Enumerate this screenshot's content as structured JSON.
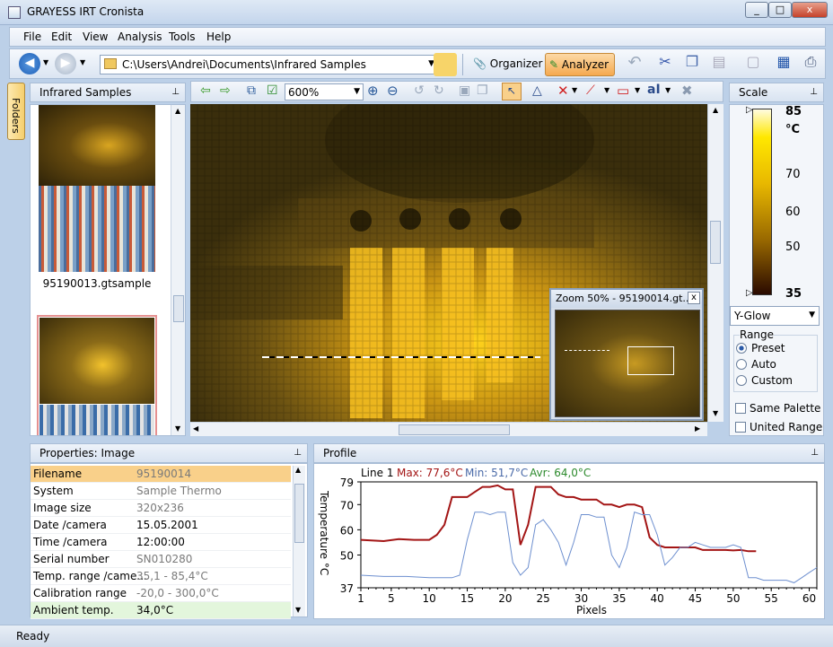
{
  "window": {
    "title": "GRAYESS IRT Cronista",
    "min": "_",
    "max": "□",
    "close": "x"
  },
  "menu": [
    "File",
    "Edit",
    "View",
    "Analysis",
    "Tools",
    "Help"
  ],
  "toolbar": {
    "path": "C:\\Users\\Andrei\\Documents\\Infrared Samples",
    "organizer": "Organizer",
    "analyzer": "Analyzer"
  },
  "side_tab": "Folders",
  "thumbs": {
    "title": "Infrared Samples",
    "item1": "95190013.gtsample"
  },
  "view_toolbar": {
    "zoom": "600%"
  },
  "zoom_window": {
    "title": "Zoom 50% - 95190014.gt...",
    "close": "x"
  },
  "scale": {
    "title": "Scale",
    "max": "85",
    "unit": "°C",
    "ticks": [
      "70",
      "60",
      "50"
    ],
    "min": "35",
    "palette": "Y-Glow",
    "range_label": "Range",
    "preset": "Preset",
    "auto": "Auto",
    "custom": "Custom",
    "same_palette": "Same Palette",
    "united_range": "United Range"
  },
  "properties": {
    "title": "Properties: Image",
    "rows": [
      {
        "k": "Filename",
        "v": "95190014"
      },
      {
        "k": "System",
        "v": "Sample Thermo"
      },
      {
        "k": "Image size",
        "v": "320x236"
      },
      {
        "k": "Date /camera",
        "v": "15.05.2001"
      },
      {
        "k": "Time /camera",
        "v": "12:00:00"
      },
      {
        "k": "Serial number",
        "v": "SN010280"
      },
      {
        "k": "Temp. range /came...",
        "v": "35,1 - 85,4°C"
      },
      {
        "k": "Calibration range",
        "v": "-20,0 - 300,0°C"
      },
      {
        "k": "Ambient temp.",
        "v": "34,0°C"
      }
    ]
  },
  "profile": {
    "title": "Profile",
    "line": "Line 1",
    "max": "Max: 77,6°C",
    "min": "Min: 51,7°C",
    "avr": "Avr: 64,0°C",
    "ylabel": "Temperature °C",
    "xlabel": "Pixels"
  },
  "status": "Ready",
  "colors": {
    "accent": "#f5a94f",
    "max": "#a31515",
    "min": "#6d8fcf",
    "avr": "#2c8a2c"
  },
  "chart_data": {
    "type": "line",
    "title": "",
    "xlabel": "Pixels",
    "ylabel": "Temperature °C",
    "xlim": [
      1,
      61
    ],
    "ylim": [
      37,
      79
    ],
    "xticks": [
      1,
      5,
      10,
      15,
      20,
      25,
      30,
      35,
      40,
      45,
      50,
      55,
      60
    ],
    "yticks": [
      37,
      50,
      60,
      70,
      79
    ],
    "series": [
      {
        "name": "Max",
        "x": [
          1,
          4,
          6,
          8,
          10,
          11,
          12,
          13,
          14,
          15,
          16,
          17,
          18,
          19,
          20,
          21,
          22,
          23,
          24,
          25,
          26,
          27,
          28,
          29,
          30,
          31,
          32,
          33,
          34,
          35,
          36,
          37,
          38,
          39,
          40,
          41,
          42,
          43,
          44,
          45,
          46,
          47,
          48,
          49,
          50,
          51,
          52,
          53
        ],
        "y": [
          56,
          55.5,
          56.3,
          56,
          56,
          58,
          62,
          73,
          73,
          73,
          75,
          77,
          77,
          77.6,
          76,
          76,
          54,
          62,
          77,
          77,
          77,
          74,
          73,
          73,
          72,
          72,
          72,
          70,
          70,
          69,
          70,
          70,
          69,
          57,
          54,
          53,
          53,
          53,
          53,
          53,
          52,
          52,
          52,
          52,
          51.8,
          52,
          51.5,
          51.5
        ]
      },
      {
        "name": "Min",
        "x": [
          1,
          4,
          7,
          10,
          13,
          14,
          15,
          16,
          17,
          18,
          19,
          20,
          21,
          22,
          23,
          24,
          25,
          26,
          27,
          28,
          29,
          30,
          31,
          32,
          33,
          34,
          35,
          36,
          37,
          38,
          39,
          40,
          41,
          42,
          43,
          44,
          45,
          46,
          47,
          48,
          49,
          50,
          51,
          52,
          53,
          54,
          55,
          56,
          57,
          58,
          59,
          60,
          61
        ],
        "y": [
          42,
          41.5,
          41.5,
          41,
          41,
          42,
          56,
          67,
          67,
          66,
          67,
          67,
          47,
          42,
          45,
          62,
          64,
          60,
          55,
          46,
          55,
          66,
          66,
          65,
          65,
          50,
          45,
          53,
          67,
          66,
          66,
          58,
          46,
          49,
          53,
          53,
          55,
          54,
          53,
          53,
          53,
          54,
          53,
          41,
          41,
          40,
          40,
          40,
          40,
          39,
          41,
          43,
          45
        ]
      }
    ]
  }
}
